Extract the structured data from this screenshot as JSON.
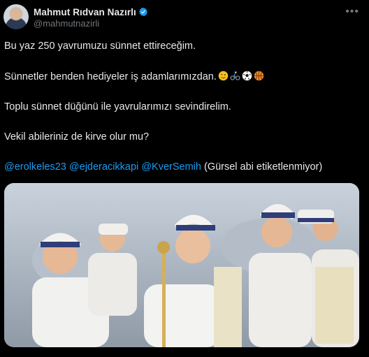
{
  "author": {
    "display_name": "Mahmut Rıdvan Nazırlı",
    "handle": "@mahmutnazirli",
    "verified_icon": "verified-badge-icon",
    "more_icon": "more-options-icon"
  },
  "tweet": {
    "line1": "Bu yaz 250 yavrumuzu sünnet ettireceğim.",
    "line2": "Sünnetler benden hediyeler iş adamlarımızdan.",
    "line2_emojis": [
      "winking-face-icon",
      "cyclist-icon",
      "soccer-ball-icon",
      "basketball-icon"
    ],
    "line3": "Toplu sünnet düğünü ile yavrularımızı sevindirelim.",
    "line4": "Vekil abileriniz de kirve olur mu?",
    "mentions": [
      "@erolkeles23",
      "@ejderacikkapi",
      "@KverSemih"
    ],
    "line5_suffix": "(Gürsel abi etiketlenmiyor)"
  },
  "media": {
    "description_icon": "photo-children-circumcision-ceremony"
  },
  "colors": {
    "background": "#000000",
    "text": "#e7e9ea",
    "secondary": "#71767b",
    "link": "#1d9bf0"
  }
}
